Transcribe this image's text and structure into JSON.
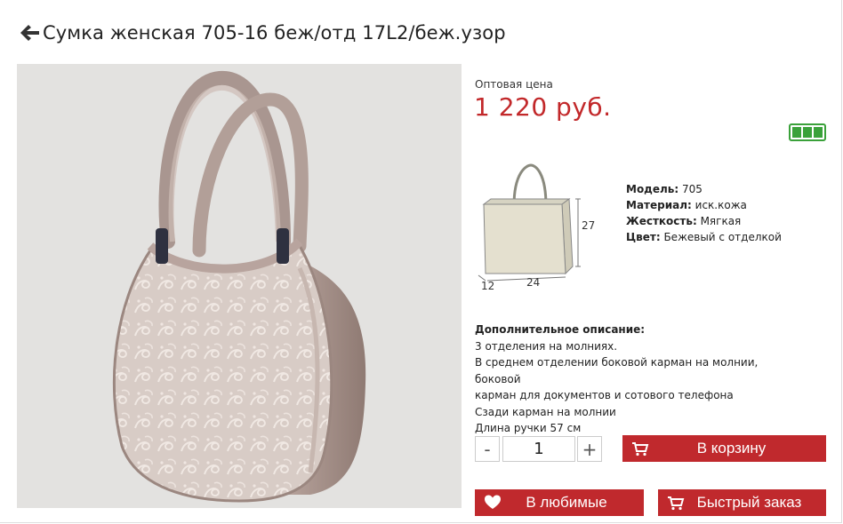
{
  "header": {
    "title": "Сумка женская 705-16 беж/отд 17L2/беж.узор"
  },
  "price": {
    "label": "Оптовая цена",
    "value": "1 220 руб."
  },
  "dimensions": {
    "height": "27",
    "depth": "12",
    "width": "24"
  },
  "specs": [
    {
      "label": "Модель:",
      "value": "705"
    },
    {
      "label": "Материал:",
      "value": "иск.кожа"
    },
    {
      "label": "Жесткость:",
      "value": "Мягкая"
    },
    {
      "label": "Цвет:",
      "value": "Бежевый с отделкой"
    }
  ],
  "description": {
    "title": "Дополнительное описание:",
    "lines": [
      "3 отделения на молниях.",
      "В среднем отделении боковой карман на молнии, боковой",
      "карман для документов и сотового телефона",
      "Сзади карман на молнии",
      "Длина ручки 57 см"
    ]
  },
  "quantity": {
    "minus": "-",
    "plus": "+",
    "value": "1"
  },
  "buttons": {
    "cart": "В корзину",
    "favorites": "В любимые",
    "quick_order": "Быстрый заказ"
  },
  "colors": {
    "accent": "#c0292d",
    "price": "#c2282a",
    "stock": "#3aa13a"
  }
}
